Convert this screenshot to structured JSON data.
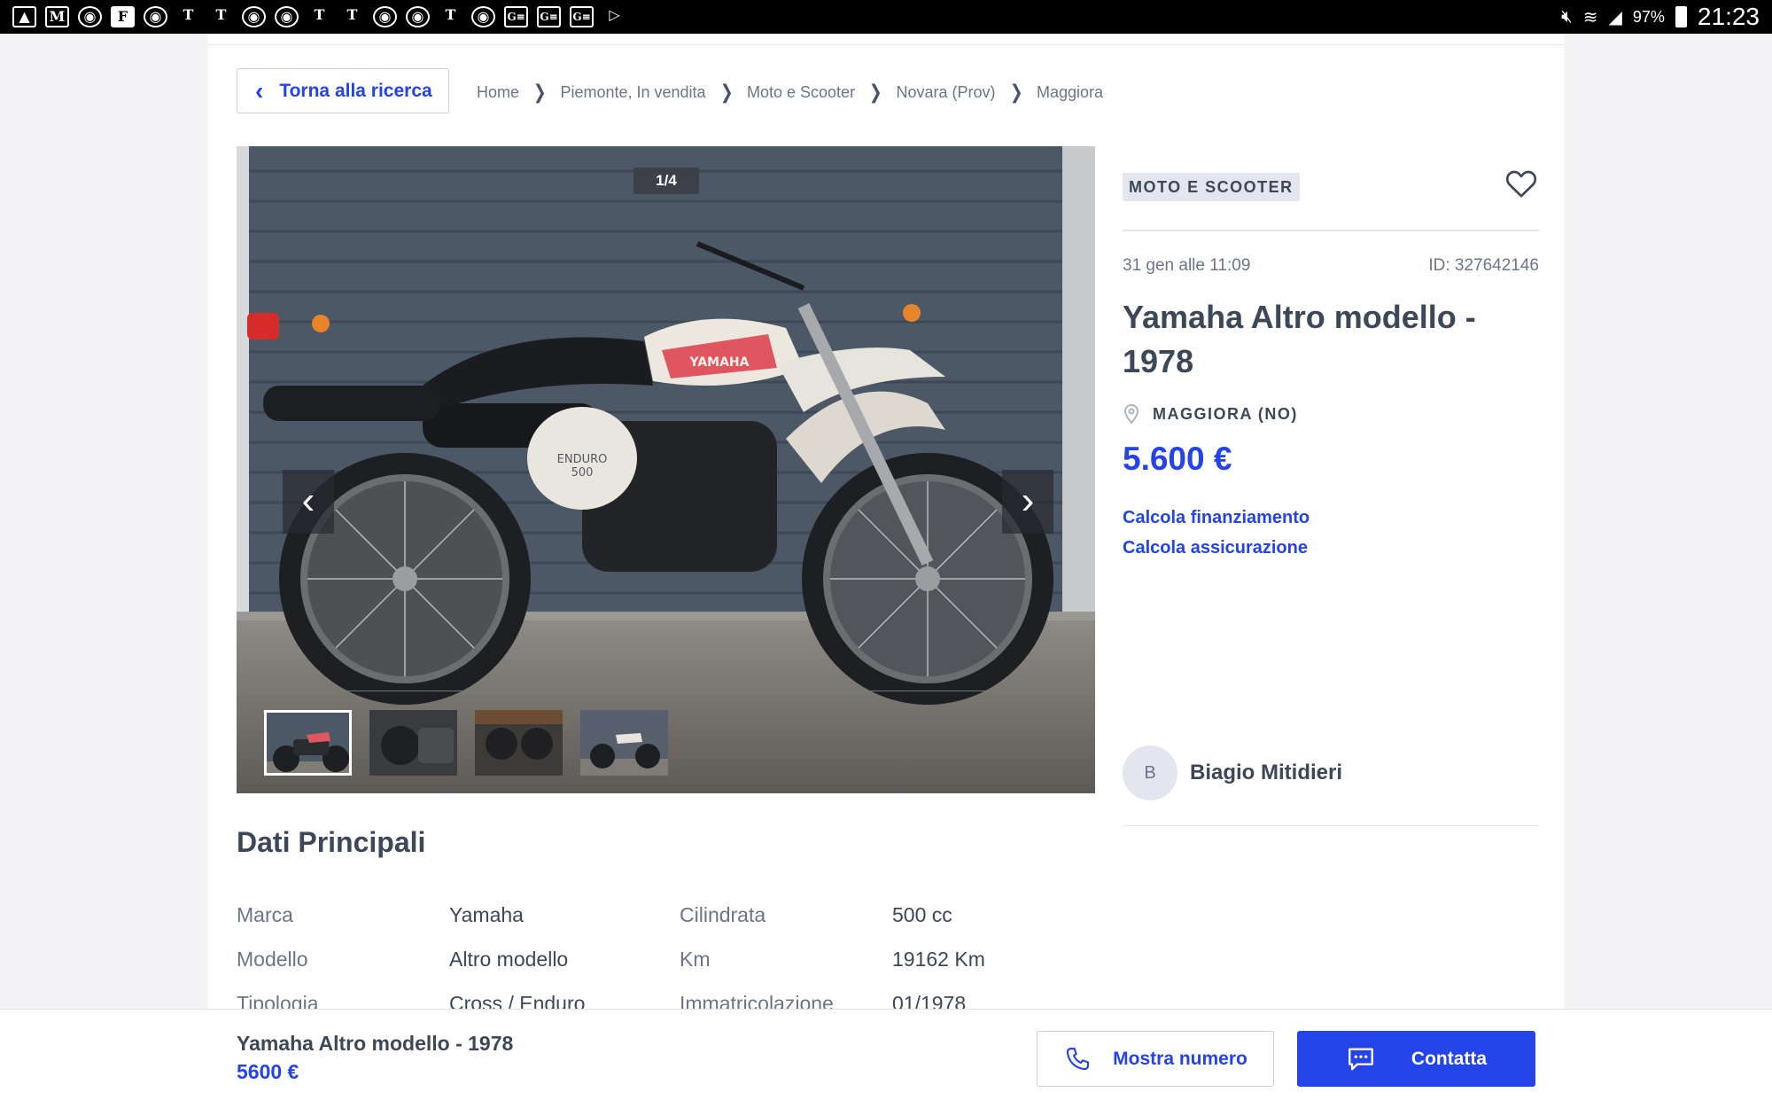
{
  "status_bar": {
    "notification_icons": [
      "gallery-icon",
      "gmail-icon",
      "chrome-icon",
      "flipboard-icon",
      "chrome-icon",
      "nytimes-icon",
      "nytimes-icon",
      "chrome-icon",
      "chrome-icon",
      "nytimes-icon",
      "nytimes-icon",
      "chrome-icon",
      "chrome-icon",
      "nytimes-icon",
      "chrome-icon",
      "google-news-icon",
      "google-news-icon",
      "google-news-icon",
      "play-store-icon"
    ],
    "battery": "97%",
    "time": "21:23"
  },
  "nav": {
    "back_label": "Torna alla ricerca",
    "breadcrumb": [
      "Home",
      "Piemonte, In vendita",
      "Moto e Scooter",
      "Novara (Prov)",
      "Maggiora"
    ]
  },
  "gallery": {
    "counter": "1/4",
    "thumbnail_count": 4,
    "active_index": 0
  },
  "listing": {
    "category": "MOTO E SCOOTER",
    "date": "31 gen alle 11:09",
    "id_label": "ID: 327642146",
    "title": "Yamaha Altro modello - 1978",
    "location": "MAGGIORA (NO)",
    "price": "5.600 €",
    "link_financing": "Calcola finanziamento",
    "link_insurance": "Calcola assicurazione",
    "seller_initial": "B",
    "seller_name": "Biagio Mitidieri"
  },
  "details": {
    "section_title": "Dati Principali",
    "rows": [
      {
        "label1": "Marca",
        "value1": "Yamaha",
        "label2": "Cilindrata",
        "value2": "500 cc"
      },
      {
        "label1": "Modello",
        "value1": "Altro modello",
        "label2": "Km",
        "value2": "19162 Km"
      },
      {
        "label1": "Tipologia",
        "value1": "Cross / Enduro",
        "label2": "Immatricolazione",
        "value2": "01/1978"
      }
    ]
  },
  "bottom_bar": {
    "title": "Yamaha Altro modello - 1978",
    "price": "5600 €",
    "phone_label": "Mostra numero",
    "contact_label": "Contatta"
  },
  "colors": {
    "accent": "#2443e8",
    "text": "#3c4858",
    "muted": "#6b7588",
    "badge_bg": "#e4e6ef"
  }
}
